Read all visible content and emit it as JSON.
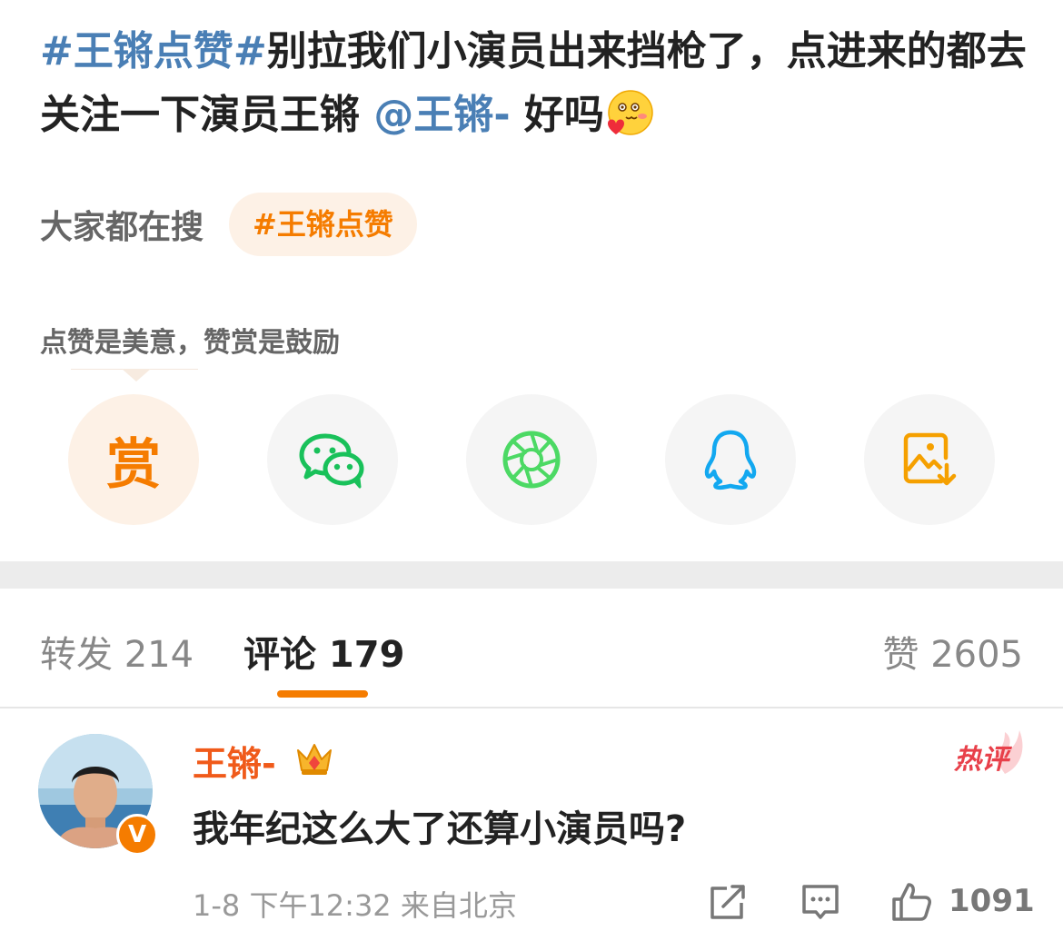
{
  "post": {
    "hashtag": "#王锵点赞#",
    "text_part1": "别拉我们小演员出来挡枪了，点进来的都去关注一下演员王锵 ",
    "mention": "@王锵-",
    "text_part2": " 好吗",
    "emoji_icon": "blushing-heart-emoji"
  },
  "search": {
    "label": "大家都在搜",
    "chip": "#王锵点赞"
  },
  "reward": {
    "caption": "点赞是美意，赞赏是鼓励",
    "button_label": "赏"
  },
  "share": {
    "icons": [
      "reward-icon",
      "wechat-icon",
      "moments-icon",
      "qq-icon",
      "save-image-icon"
    ]
  },
  "tabs": {
    "repost": "转发 214",
    "comments": "评论 179",
    "likes": "赞 2605"
  },
  "comment": {
    "author": "王锵-",
    "verified_badge": "V",
    "hot_label": "热评",
    "text": "我年纪这么大了还算小演员吗?",
    "meta": "1-8 下午12:32 来自北京",
    "like_count": "1091"
  },
  "colors": {
    "accent": "#f57c00",
    "link": "#4a7fb5",
    "wechat": "#19c15a",
    "qq": "#12a8f0",
    "hot": "#e8404a"
  }
}
